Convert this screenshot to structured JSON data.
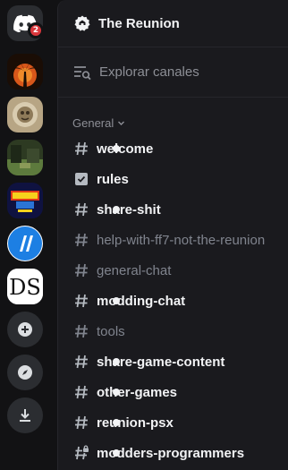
{
  "rail": {
    "home_badge": "2",
    "servers": [
      {
        "name": "server-palm-sunset",
        "bg": "#c25410"
      },
      {
        "name": "server-sepia-emblem",
        "bg": "#b9a98a"
      },
      {
        "name": "server-green-field",
        "bg": "#4a6b3a"
      },
      {
        "name": "server-street-fighter",
        "bg": "#1a1d6b"
      },
      {
        "name": "server-blue-ii",
        "bg": "#1c7ae0"
      },
      {
        "name": "server-ds",
        "bg": "#ffffff"
      }
    ],
    "actions": [
      "add-server",
      "discover",
      "download"
    ]
  },
  "server": {
    "name": "The Reunion",
    "browse_label": "Explorar canales",
    "category": "General"
  },
  "channels": [
    {
      "label": "welcome",
      "state": "unread",
      "icon": "hash"
    },
    {
      "label": "rules",
      "state": "unread",
      "icon": "rules"
    },
    {
      "label": "share-shit",
      "state": "unread",
      "icon": "hash"
    },
    {
      "label": "help-with-ff7-not-the-reunion",
      "state": "read",
      "icon": "hash"
    },
    {
      "label": "general-chat",
      "state": "read",
      "icon": "hash"
    },
    {
      "label": "modding-chat",
      "state": "unread",
      "icon": "hash"
    },
    {
      "label": "tools",
      "state": "read",
      "icon": "hash"
    },
    {
      "label": "share-game-content",
      "state": "unread",
      "icon": "hash"
    },
    {
      "label": "other-games",
      "state": "unread",
      "icon": "hash"
    },
    {
      "label": "reunion-psx",
      "state": "unread",
      "icon": "hash"
    },
    {
      "label": "modders-programmers",
      "state": "unread",
      "icon": "hash-lock"
    }
  ],
  "colors": {
    "accent_badge": "#da373c",
    "unread_text": "#f2f3f5",
    "read_text": "#80848e"
  }
}
